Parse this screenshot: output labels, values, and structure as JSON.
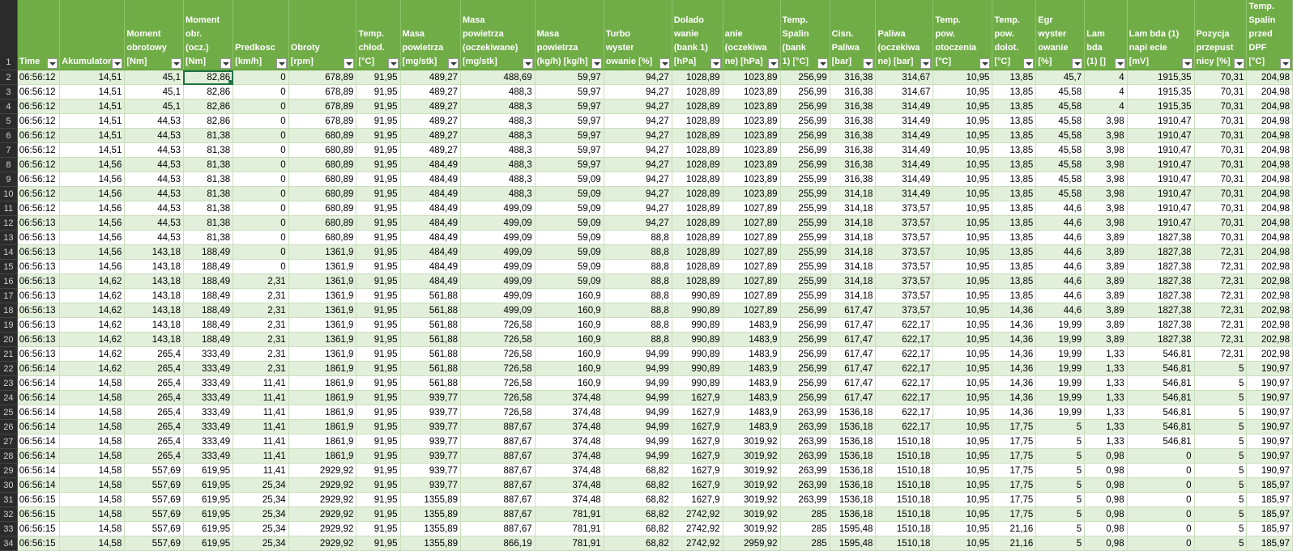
{
  "column_headers": [
    {
      "label": "Time"
    },
    {
      "label": "Akumulator"
    },
    {
      "label": "Moment obrotowy [Nm]"
    },
    {
      "label": "Moment obr. (ocz.) [Nm]"
    },
    {
      "label": "Predkosc [km/h]"
    },
    {
      "label": "Obroty [rpm]"
    },
    {
      "label": "Temp. chłod. [°C]"
    },
    {
      "label": "Masa powietrza [mg/stk]"
    },
    {
      "label": "Masa powietrza (oczekiwane) [mg/stk]"
    },
    {
      "label": "Masa powietrza (kg/h) [kg/h]"
    },
    {
      "label": "Turbo wyster owanie [%]"
    },
    {
      "label": "Dolado wanie (bank 1) [hPa]"
    },
    {
      "label": "anie (oczekiwa ne) [hPa]"
    },
    {
      "label": "Temp. Spalin (bank 1) [°C]"
    },
    {
      "label": "Cisn. Paliwa [bar]"
    },
    {
      "label": "Paliwa (oczekiwa ne) [bar]"
    },
    {
      "label": "Temp. pow. otoczenia [°C]"
    },
    {
      "label": "Temp. pow. dolot. [°C]"
    },
    {
      "label": "Egr wyster owanie [%]"
    },
    {
      "label": "Lam bda (1) []"
    },
    {
      "label": "Lam bda (1) napi ecie [mV]"
    },
    {
      "label": "Pozycja przepust nicy [%]"
    },
    {
      "label": "Temp. Spalin przed DPF [°C]"
    }
  ],
  "header_row_number": "1",
  "selected_cell": {
    "row": 0,
    "col": 3
  },
  "rows": [
    {
      "n": "2",
      "cells": [
        "06:56:12",
        "14,51",
        "45,1",
        "82,86",
        "0",
        "678,89",
        "91,95",
        "489,27",
        "488,69",
        "59,97",
        "94,27",
        "1028,89",
        "1023,89",
        "256,99",
        "316,38",
        "314,67",
        "10,95",
        "13,85",
        "45,7",
        "4",
        "1915,35",
        "70,31",
        "204,98"
      ]
    },
    {
      "n": "3",
      "cells": [
        "06:56:12",
        "14,51",
        "45,1",
        "82,86",
        "0",
        "678,89",
        "91,95",
        "489,27",
        "488,3",
        "59,97",
        "94,27",
        "1028,89",
        "1023,89",
        "256,99",
        "316,38",
        "314,67",
        "10,95",
        "13,85",
        "45,58",
        "4",
        "1915,35",
        "70,31",
        "204,98"
      ]
    },
    {
      "n": "4",
      "cells": [
        "06:56:12",
        "14,51",
        "45,1",
        "82,86",
        "0",
        "678,89",
        "91,95",
        "489,27",
        "488,3",
        "59,97",
        "94,27",
        "1028,89",
        "1023,89",
        "256,99",
        "316,38",
        "314,49",
        "10,95",
        "13,85",
        "45,58",
        "4",
        "1915,35",
        "70,31",
        "204,98"
      ]
    },
    {
      "n": "5",
      "cells": [
        "06:56:12",
        "14,51",
        "44,53",
        "82,86",
        "0",
        "678,89",
        "91,95",
        "489,27",
        "488,3",
        "59,97",
        "94,27",
        "1028,89",
        "1023,89",
        "256,99",
        "316,38",
        "314,49",
        "10,95",
        "13,85",
        "45,58",
        "3,98",
        "1910,47",
        "70,31",
        "204,98"
      ]
    },
    {
      "n": "6",
      "cells": [
        "06:56:12",
        "14,51",
        "44,53",
        "81,38",
        "0",
        "680,89",
        "91,95",
        "489,27",
        "488,3",
        "59,97",
        "94,27",
        "1028,89",
        "1023,89",
        "256,99",
        "316,38",
        "314,49",
        "10,95",
        "13,85",
        "45,58",
        "3,98",
        "1910,47",
        "70,31",
        "204,98"
      ]
    },
    {
      "n": "7",
      "cells": [
        "06:56:12",
        "14,51",
        "44,53",
        "81,38",
        "0",
        "680,89",
        "91,95",
        "489,27",
        "488,3",
        "59,97",
        "94,27",
        "1028,89",
        "1023,89",
        "256,99",
        "316,38",
        "314,49",
        "10,95",
        "13,85",
        "45,58",
        "3,98",
        "1910,47",
        "70,31",
        "204,98"
      ]
    },
    {
      "n": "8",
      "cells": [
        "06:56:12",
        "14,56",
        "44,53",
        "81,38",
        "0",
        "680,89",
        "91,95",
        "484,49",
        "488,3",
        "59,97",
        "94,27",
        "1028,89",
        "1023,89",
        "256,99",
        "316,38",
        "314,49",
        "10,95",
        "13,85",
        "45,58",
        "3,98",
        "1910,47",
        "70,31",
        "204,98"
      ]
    },
    {
      "n": "9",
      "cells": [
        "06:56:12",
        "14,56",
        "44,53",
        "81,38",
        "0",
        "680,89",
        "91,95",
        "484,49",
        "488,3",
        "59,09",
        "94,27",
        "1028,89",
        "1023,89",
        "255,99",
        "316,38",
        "314,49",
        "10,95",
        "13,85",
        "45,58",
        "3,98",
        "1910,47",
        "70,31",
        "204,98"
      ]
    },
    {
      "n": "10",
      "cells": [
        "06:56:12",
        "14,56",
        "44,53",
        "81,38",
        "0",
        "680,89",
        "91,95",
        "484,49",
        "488,3",
        "59,09",
        "94,27",
        "1028,89",
        "1023,89",
        "255,99",
        "314,18",
        "314,49",
        "10,95",
        "13,85",
        "45,58",
        "3,98",
        "1910,47",
        "70,31",
        "204,98"
      ]
    },
    {
      "n": "11",
      "cells": [
        "06:56:12",
        "14,56",
        "44,53",
        "81,38",
        "0",
        "680,89",
        "91,95",
        "484,49",
        "499,09",
        "59,09",
        "94,27",
        "1028,89",
        "1027,89",
        "255,99",
        "314,18",
        "373,57",
        "10,95",
        "13,85",
        "44,6",
        "3,98",
        "1910,47",
        "70,31",
        "204,98"
      ]
    },
    {
      "n": "12",
      "cells": [
        "06:56:13",
        "14,56",
        "44,53",
        "81,38",
        "0",
        "680,89",
        "91,95",
        "484,49",
        "499,09",
        "59,09",
        "94,27",
        "1028,89",
        "1027,89",
        "255,99",
        "314,18",
        "373,57",
        "10,95",
        "13,85",
        "44,6",
        "3,98",
        "1910,47",
        "70,31",
        "204,98"
      ]
    },
    {
      "n": "13",
      "cells": [
        "06:56:13",
        "14,56",
        "44,53",
        "81,38",
        "0",
        "680,89",
        "91,95",
        "484,49",
        "499,09",
        "59,09",
        "88,8",
        "1028,89",
        "1027,89",
        "255,99",
        "314,18",
        "373,57",
        "10,95",
        "13,85",
        "44,6",
        "3,89",
        "1827,38",
        "70,31",
        "204,98"
      ]
    },
    {
      "n": "14",
      "cells": [
        "06:56:13",
        "14,56",
        "143,18",
        "188,49",
        "0",
        "1361,9",
        "91,95",
        "484,49",
        "499,09",
        "59,09",
        "88,8",
        "1028,89",
        "1027,89",
        "255,99",
        "314,18",
        "373,57",
        "10,95",
        "13,85",
        "44,6",
        "3,89",
        "1827,38",
        "72,31",
        "204,98"
      ]
    },
    {
      "n": "15",
      "cells": [
        "06:56:13",
        "14,56",
        "143,18",
        "188,49",
        "0",
        "1361,9",
        "91,95",
        "484,49",
        "499,09",
        "59,09",
        "88,8",
        "1028,89",
        "1027,89",
        "255,99",
        "314,18",
        "373,57",
        "10,95",
        "13,85",
        "44,6",
        "3,89",
        "1827,38",
        "72,31",
        "202,98"
      ]
    },
    {
      "n": "16",
      "cells": [
        "06:56:13",
        "14,62",
        "143,18",
        "188,49",
        "2,31",
        "1361,9",
        "91,95",
        "484,49",
        "499,09",
        "59,09",
        "88,8",
        "1028,89",
        "1027,89",
        "255,99",
        "314,18",
        "373,57",
        "10,95",
        "13,85",
        "44,6",
        "3,89",
        "1827,38",
        "72,31",
        "202,98"
      ]
    },
    {
      "n": "17",
      "cells": [
        "06:56:13",
        "14,62",
        "143,18",
        "188,49",
        "2,31",
        "1361,9",
        "91,95",
        "561,88",
        "499,09",
        "160,9",
        "88,8",
        "990,89",
        "1027,89",
        "255,99",
        "314,18",
        "373,57",
        "10,95",
        "13,85",
        "44,6",
        "3,89",
        "1827,38",
        "72,31",
        "202,98"
      ]
    },
    {
      "n": "18",
      "cells": [
        "06:56:13",
        "14,62",
        "143,18",
        "188,49",
        "2,31",
        "1361,9",
        "91,95",
        "561,88",
        "499,09",
        "160,9",
        "88,8",
        "990,89",
        "1027,89",
        "256,99",
        "617,47",
        "373,57",
        "10,95",
        "14,36",
        "44,6",
        "3,89",
        "1827,38",
        "72,31",
        "202,98"
      ]
    },
    {
      "n": "19",
      "cells": [
        "06:56:13",
        "14,62",
        "143,18",
        "188,49",
        "2,31",
        "1361,9",
        "91,95",
        "561,88",
        "726,58",
        "160,9",
        "88,8",
        "990,89",
        "1483,9",
        "256,99",
        "617,47",
        "622,17",
        "10,95",
        "14,36",
        "19,99",
        "3,89",
        "1827,38",
        "72,31",
        "202,98"
      ]
    },
    {
      "n": "20",
      "cells": [
        "06:56:13",
        "14,62",
        "143,18",
        "188,49",
        "2,31",
        "1361,9",
        "91,95",
        "561,88",
        "726,58",
        "160,9",
        "88,8",
        "990,89",
        "1483,9",
        "256,99",
        "617,47",
        "622,17",
        "10,95",
        "14,36",
        "19,99",
        "3,89",
        "1827,38",
        "72,31",
        "202,98"
      ]
    },
    {
      "n": "21",
      "cells": [
        "06:56:13",
        "14,62",
        "265,4",
        "333,49",
        "2,31",
        "1361,9",
        "91,95",
        "561,88",
        "726,58",
        "160,9",
        "94,99",
        "990,89",
        "1483,9",
        "256,99",
        "617,47",
        "622,17",
        "10,95",
        "14,36",
        "19,99",
        "1,33",
        "546,81",
        "72,31",
        "202,98"
      ]
    },
    {
      "n": "22",
      "cells": [
        "06:56:14",
        "14,62",
        "265,4",
        "333,49",
        "2,31",
        "1861,9",
        "91,95",
        "561,88",
        "726,58",
        "160,9",
        "94,99",
        "990,89",
        "1483,9",
        "256,99",
        "617,47",
        "622,17",
        "10,95",
        "14,36",
        "19,99",
        "1,33",
        "546,81",
        "5",
        "190,97"
      ]
    },
    {
      "n": "23",
      "cells": [
        "06:56:14",
        "14,58",
        "265,4",
        "333,49",
        "11,41",
        "1861,9",
        "91,95",
        "561,88",
        "726,58",
        "160,9",
        "94,99",
        "990,89",
        "1483,9",
        "256,99",
        "617,47",
        "622,17",
        "10,95",
        "14,36",
        "19,99",
        "1,33",
        "546,81",
        "5",
        "190,97"
      ]
    },
    {
      "n": "24",
      "cells": [
        "06:56:14",
        "14,58",
        "265,4",
        "333,49",
        "11,41",
        "1861,9",
        "91,95",
        "939,77",
        "726,58",
        "374,48",
        "94,99",
        "1627,9",
        "1483,9",
        "256,99",
        "617,47",
        "622,17",
        "10,95",
        "14,36",
        "19,99",
        "1,33",
        "546,81",
        "5",
        "190,97"
      ]
    },
    {
      "n": "25",
      "cells": [
        "06:56:14",
        "14,58",
        "265,4",
        "333,49",
        "11,41",
        "1861,9",
        "91,95",
        "939,77",
        "726,58",
        "374,48",
        "94,99",
        "1627,9",
        "1483,9",
        "263,99",
        "1536,18",
        "622,17",
        "10,95",
        "14,36",
        "19,99",
        "1,33",
        "546,81",
        "5",
        "190,97"
      ]
    },
    {
      "n": "26",
      "cells": [
        "06:56:14",
        "14,58",
        "265,4",
        "333,49",
        "11,41",
        "1861,9",
        "91,95",
        "939,77",
        "887,67",
        "374,48",
        "94,99",
        "1627,9",
        "1483,9",
        "263,99",
        "1536,18",
        "622,17",
        "10,95",
        "17,75",
        "5",
        "1,33",
        "546,81",
        "5",
        "190,97"
      ]
    },
    {
      "n": "27",
      "cells": [
        "06:56:14",
        "14,58",
        "265,4",
        "333,49",
        "11,41",
        "1861,9",
        "91,95",
        "939,77",
        "887,67",
        "374,48",
        "94,99",
        "1627,9",
        "3019,92",
        "263,99",
        "1536,18",
        "1510,18",
        "10,95",
        "17,75",
        "5",
        "1,33",
        "546,81",
        "5",
        "190,97"
      ]
    },
    {
      "n": "28",
      "cells": [
        "06:56:14",
        "14,58",
        "265,4",
        "333,49",
        "11,41",
        "1861,9",
        "91,95",
        "939,77",
        "887,67",
        "374,48",
        "94,99",
        "1627,9",
        "3019,92",
        "263,99",
        "1536,18",
        "1510,18",
        "10,95",
        "17,75",
        "5",
        "0,98",
        "0",
        "5",
        "190,97"
      ]
    },
    {
      "n": "29",
      "cells": [
        "06:56:14",
        "14,58",
        "557,69",
        "619,95",
        "11,41",
        "2929,92",
        "91,95",
        "939,77",
        "887,67",
        "374,48",
        "68,82",
        "1627,9",
        "3019,92",
        "263,99",
        "1536,18",
        "1510,18",
        "10,95",
        "17,75",
        "5",
        "0,98",
        "0",
        "5",
        "190,97"
      ]
    },
    {
      "n": "30",
      "cells": [
        "06:56:14",
        "14,58",
        "557,69",
        "619,95",
        "25,34",
        "2929,92",
        "91,95",
        "939,77",
        "887,67",
        "374,48",
        "68,82",
        "1627,9",
        "3019,92",
        "263,99",
        "1536,18",
        "1510,18",
        "10,95",
        "17,75",
        "5",
        "0,98",
        "0",
        "5",
        "185,97"
      ]
    },
    {
      "n": "31",
      "cells": [
        "06:56:15",
        "14,58",
        "557,69",
        "619,95",
        "25,34",
        "2929,92",
        "91,95",
        "1355,89",
        "887,67",
        "374,48",
        "68,82",
        "1627,9",
        "3019,92",
        "263,99",
        "1536,18",
        "1510,18",
        "10,95",
        "17,75",
        "5",
        "0,98",
        "0",
        "5",
        "185,97"
      ]
    },
    {
      "n": "32",
      "cells": [
        "06:56:15",
        "14,58",
        "557,69",
        "619,95",
        "25,34",
        "2929,92",
        "91,95",
        "1355,89",
        "887,67",
        "781,91",
        "68,82",
        "2742,92",
        "3019,92",
        "285",
        "1536,18",
        "1510,18",
        "10,95",
        "17,75",
        "5",
        "0,98",
        "0",
        "5",
        "185,97"
      ]
    },
    {
      "n": "33",
      "cells": [
        "06:56:15",
        "14,58",
        "557,69",
        "619,95",
        "25,34",
        "2929,92",
        "91,95",
        "1355,89",
        "887,67",
        "781,91",
        "68,82",
        "2742,92",
        "3019,92",
        "285",
        "1595,48",
        "1510,18",
        "10,95",
        "21,16",
        "5",
        "0,98",
        "0",
        "5",
        "185,97"
      ]
    },
    {
      "n": "34",
      "cells": [
        "06:56:15",
        "14,58",
        "557,69",
        "619,95",
        "25,34",
        "2929,92",
        "91,95",
        "1355,89",
        "866,19",
        "781,91",
        "68,82",
        "2742,92",
        "2959,92",
        "285",
        "1595,48",
        "1510,18",
        "10,95",
        "21,16",
        "5",
        "0,98",
        "0",
        "5",
        "185,97"
      ]
    }
  ]
}
